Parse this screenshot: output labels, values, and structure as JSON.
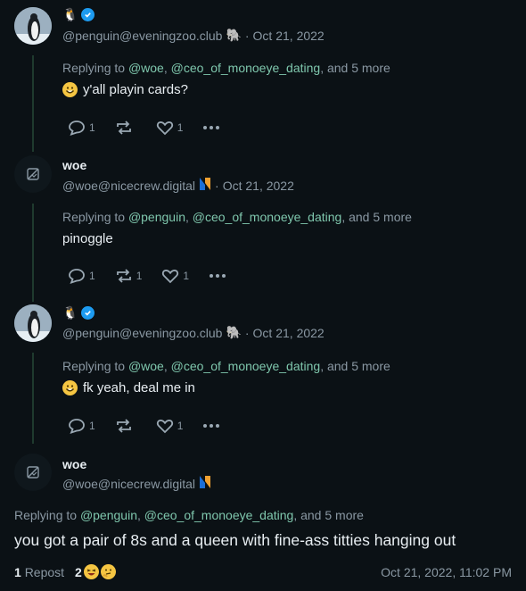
{
  "posts": [
    {
      "author": "penguin",
      "name_emoji": "🐧",
      "handle": "@penguin@eveningzoo.club",
      "date": "Oct 21, 2022",
      "replying_prefix": "Replying to",
      "mentions": [
        "@woe",
        "@ceo_of_monoeye_dating"
      ],
      "more": "and 5 more",
      "content": "y'all playin cards?",
      "replies": "1",
      "reposts": "",
      "likes": "1"
    },
    {
      "author": "woe",
      "name": "woe",
      "handle": "@woe@nicecrew.digital",
      "date": "Oct 21, 2022",
      "replying_prefix": "Replying to",
      "mentions": [
        "@penguin",
        "@ceo_of_monoeye_dating"
      ],
      "more": "and 5 more",
      "content": "pinoggle",
      "replies": "1",
      "reposts": "1",
      "likes": "1"
    },
    {
      "author": "penguin",
      "name_emoji": "🐧",
      "handle": "@penguin@eveningzoo.club",
      "date": "Oct 21, 2022",
      "replying_prefix": "Replying to",
      "mentions": [
        "@woe",
        "@ceo_of_monoeye_dating"
      ],
      "more": "and 5 more",
      "content": "fk yeah, deal me in",
      "replies": "1",
      "reposts": "",
      "likes": "1"
    }
  ],
  "focused": {
    "name": "woe",
    "handle": "@woe@nicecrew.digital",
    "replying_prefix": "Replying to",
    "mentions": [
      "@penguin",
      "@ceo_of_monoeye_dating"
    ],
    "more": "and 5 more",
    "content": "you got a pair of 8s and a queen with fine-ass titties hanging out",
    "repost_count": "1",
    "repost_label": "Repost",
    "reaction_count": "2",
    "timestamp": "Oct 21, 2022, 11:02 PM"
  },
  "colors": {
    "mention": "#7fc7ad",
    "verified": "#1d9bf0",
    "background": "#0b1115"
  }
}
